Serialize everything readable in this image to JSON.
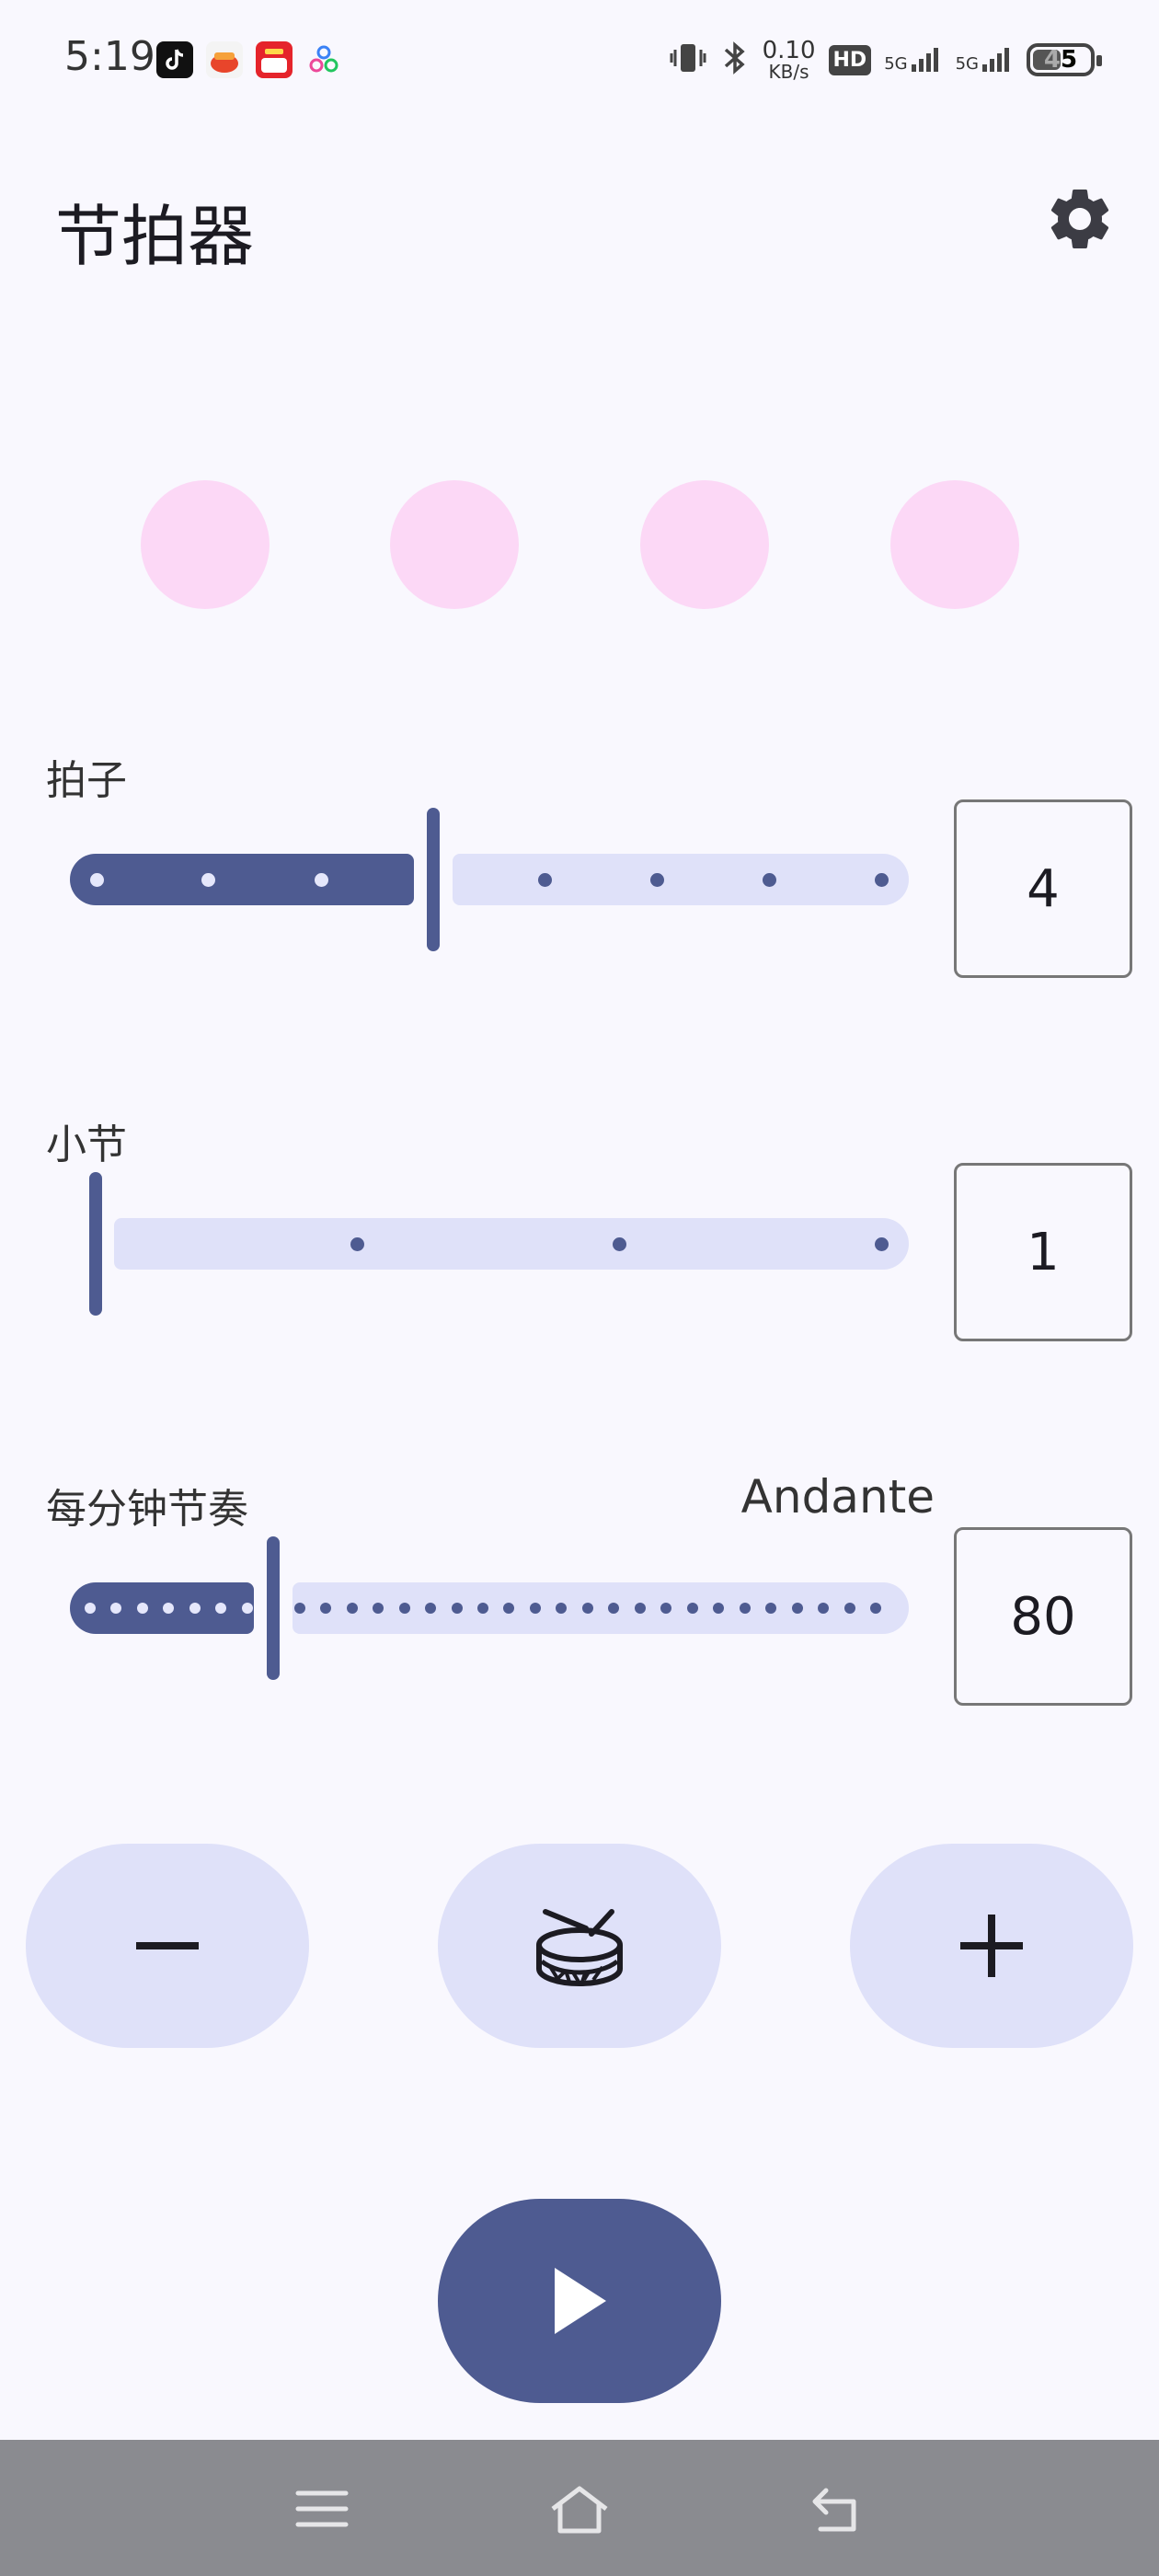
{
  "status_bar": {
    "time": "5:19",
    "net_speed_value": "0.10",
    "net_speed_unit": "KB/s",
    "hd_label": "HD",
    "sim1_label": "5G",
    "sim2_label": "5G",
    "battery_level": "45",
    "notification_icons": [
      "tiktok-icon",
      "shop-icon",
      "deal-app-icon",
      "assistant-icon"
    ]
  },
  "header": {
    "title": "节拍器",
    "settings_icon": "gear-icon"
  },
  "beats": {
    "count": 4,
    "color": "#FCD8F6"
  },
  "sliders": {
    "beats": {
      "label": "拍子",
      "value": "4",
      "min": 1,
      "max": 8,
      "current": 4
    },
    "bars": {
      "label": "小节",
      "value": "1",
      "min": 1,
      "max": 4,
      "current": 1
    },
    "bpm": {
      "label": "每分钟节奏",
      "tempo_name": "Andante",
      "value": "80",
      "ticks": 31,
      "current_tick": 7
    }
  },
  "controls": {
    "minus_icon": "minus-icon",
    "drum_icon": "drum-icon",
    "plus_icon": "plus-icon",
    "play_icon": "play-icon"
  },
  "nav": {
    "menu_icon": "menu-icon",
    "home_icon": "home-icon",
    "back_icon": "back-icon"
  },
  "colors": {
    "primary": "#4E5B91",
    "secondary_container": "#DFE1F9",
    "background": "#F9F8FE",
    "beat_inactive": "#FCD8F6"
  }
}
